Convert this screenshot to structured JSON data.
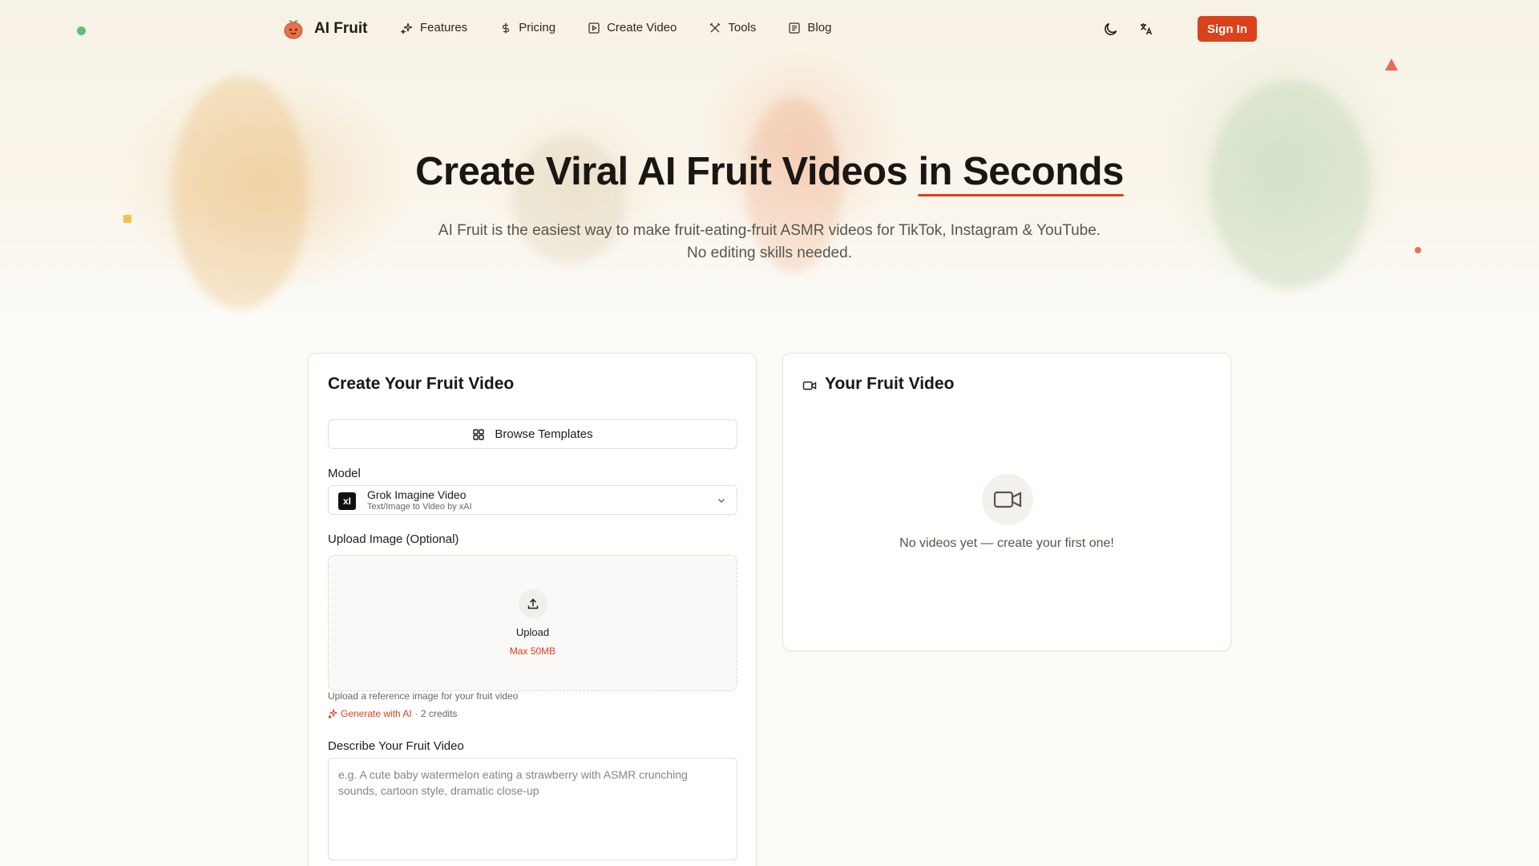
{
  "brand": {
    "name": "AI Fruit",
    "accent_color": "#d9421b"
  },
  "nav": {
    "items": [
      {
        "label": "Features",
        "icon": "sparkles-icon"
      },
      {
        "label": "Pricing",
        "icon": "dollar-icon"
      },
      {
        "label": "Create Video",
        "icon": "play-square-icon"
      },
      {
        "label": "Tools",
        "icon": "tools-icon"
      },
      {
        "label": "Blog",
        "icon": "newspaper-icon"
      }
    ],
    "theme_toggle_icon": "moon-icon",
    "language_icon": "translate-icon",
    "signin_label": "Sign In"
  },
  "hero": {
    "title_main": "Create Viral AI Fruit Videos",
    "title_accent": "in Seconds",
    "subtitle_line1": "AI Fruit is the easiest way to make fruit-eating-fruit ASMR videos for TikTok, Instagram & YouTube.",
    "subtitle_line2": "No editing skills needed."
  },
  "create_card": {
    "title": "Create Your Fruit Video",
    "browse_label": "Browse Templates",
    "model_label": "Model",
    "model": {
      "name": "Grok Imagine Video",
      "description": "Text/Image to Video by xAI",
      "logo_text": "xI"
    },
    "upload_label": "Upload Image (Optional)",
    "upload_button": "Upload",
    "upload_max": "Max 50MB",
    "upload_hint": "Upload a reference image for your fruit video",
    "generate_ai_label": "Generate with AI",
    "generate_ai_credits": "· 2 credits",
    "describe_label": "Describe Your Fruit Video",
    "describe_placeholder": "e.g. A cute baby watermelon eating a strawberry with ASMR crunching sounds, cartoon style, dramatic close-up"
  },
  "video_card": {
    "title": "Your Fruit Video",
    "empty_text": "No videos yet — create your first one!"
  }
}
